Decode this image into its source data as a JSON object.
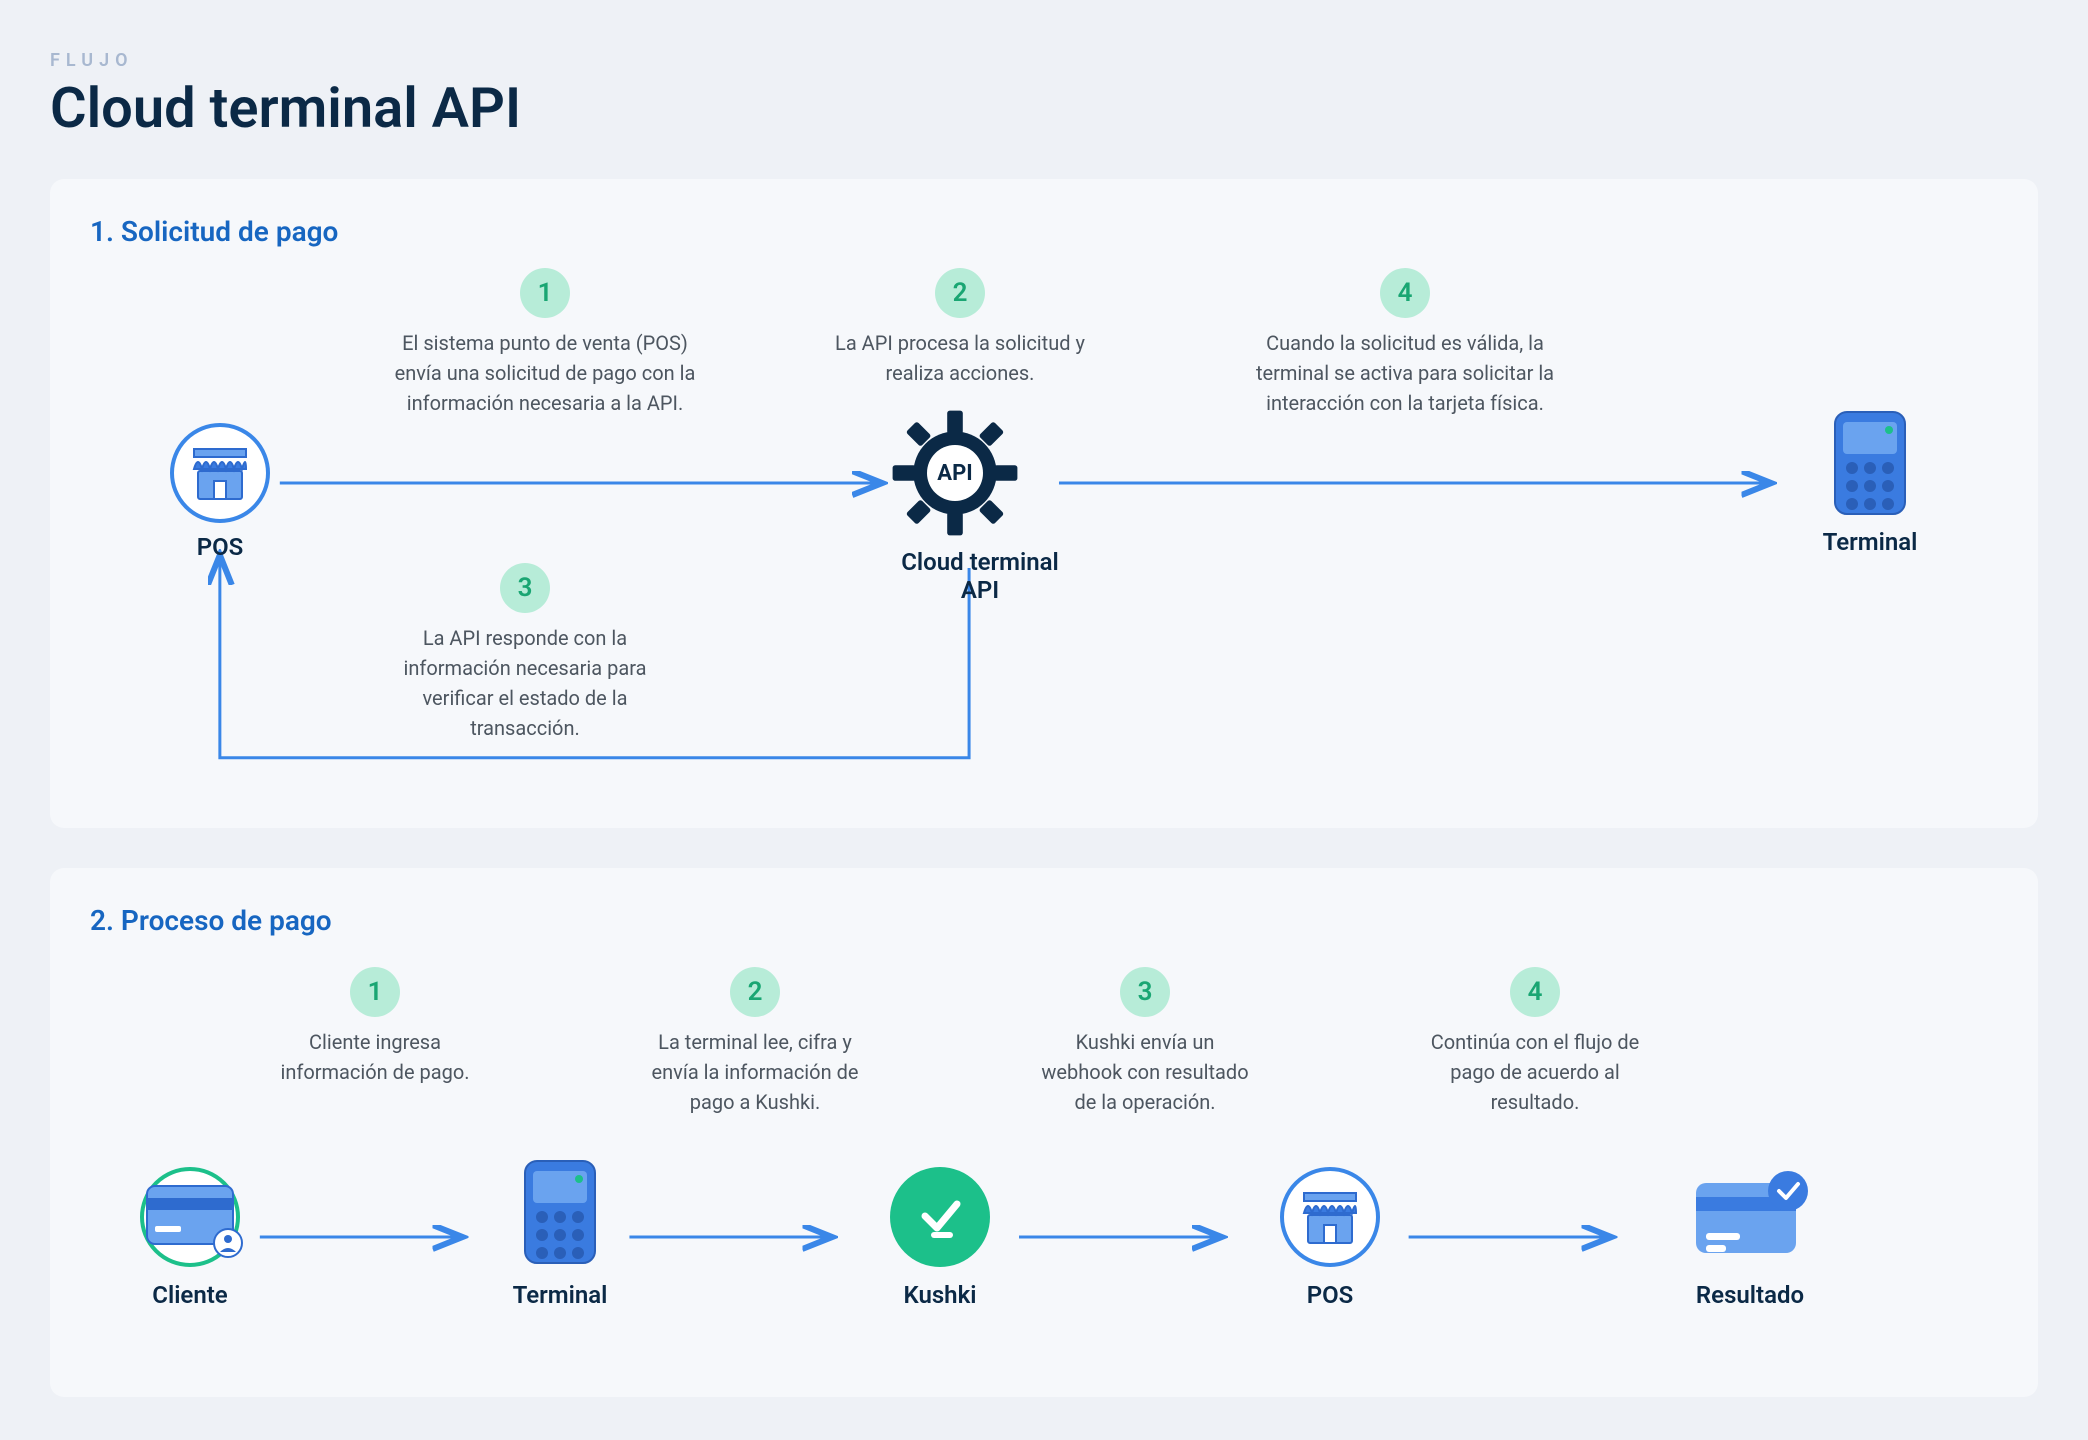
{
  "eyebrow": "FLUJO",
  "title": "Cloud terminal API",
  "section1": {
    "title": "1. Solicitud de pago",
    "nodes": {
      "pos": "POS",
      "api": "Cloud terminal API",
      "apiLabel": "API",
      "terminal": "Terminal"
    },
    "steps": {
      "s1": {
        "num": "1",
        "text": "El sistema punto de venta (POS) envía una solicitud de pago con la información necesaria a la API."
      },
      "s2": {
        "num": "2",
        "text": "La API procesa la solicitud y realiza acciones."
      },
      "s3": {
        "num": "3",
        "text": "La API responde con la información necesaria para verificar el estado de la transacción."
      },
      "s4": {
        "num": "4",
        "text": "Cuando la solicitud es válida, la terminal se activa para solicitar la interacción con la tarjeta física."
      }
    }
  },
  "section2": {
    "title": "2. Proceso de pago",
    "nodes": {
      "cliente": "Cliente",
      "terminal": "Terminal",
      "kushki": "Kushki",
      "pos": "POS",
      "resultado": "Resultado"
    },
    "steps": {
      "s1": {
        "num": "1",
        "text": "Cliente ingresa información de pago."
      },
      "s2": {
        "num": "2",
        "text": "La terminal lee, cifra y envía la información de pago a Kushki."
      },
      "s3": {
        "num": "3",
        "text": "Kushki envía un webhook con resultado de la operación."
      },
      "s4": {
        "num": "4",
        "text": "Continúa con el flujo de pago de acuerdo al resultado."
      }
    }
  }
}
